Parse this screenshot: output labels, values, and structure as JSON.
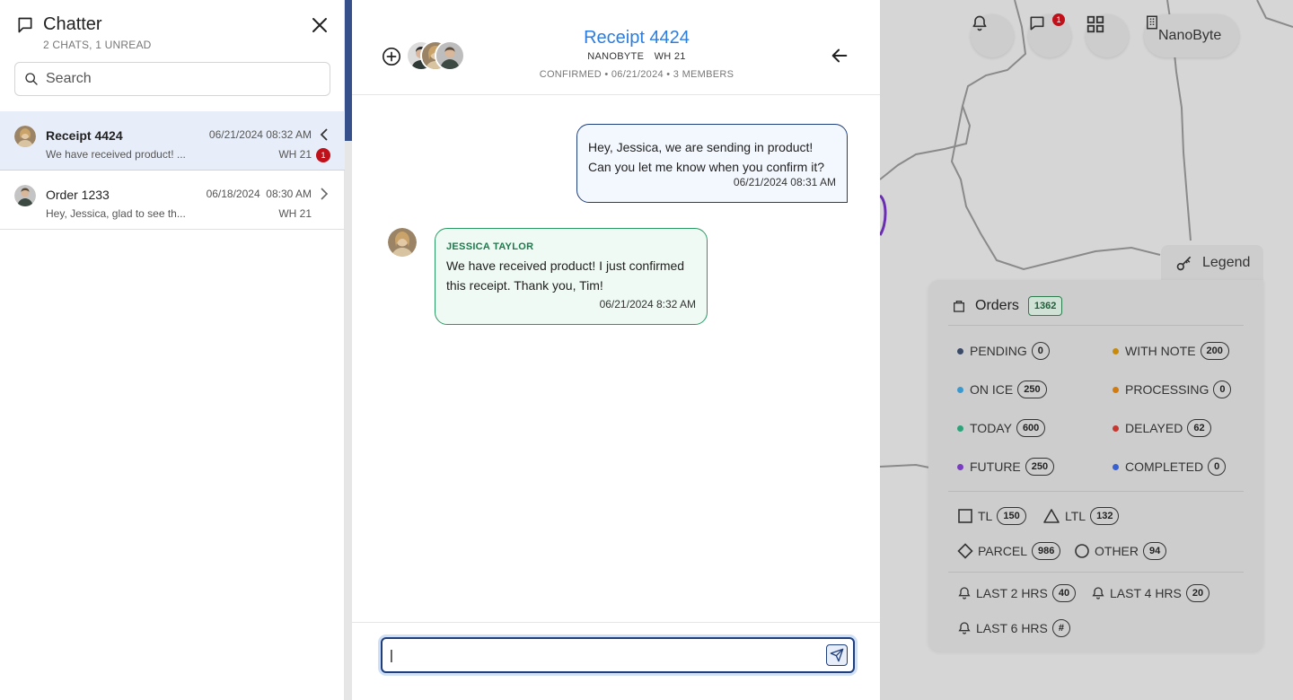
{
  "sidebar": {
    "title": "Chatter",
    "subtitle": "2 CHATS, 1 UNREAD",
    "search_placeholder": "Search",
    "chats": [
      {
        "name": "Receipt 4424",
        "time": "06/21/2024 08:32 AM",
        "preview": "We have received product! ...",
        "warehouse": "WH 21",
        "unread": "1"
      },
      {
        "name": "Order 1233",
        "time": "06/18/2024  08:30 AM",
        "preview": "Hey, Jessica, glad to see th...",
        "warehouse": "WH 21"
      }
    ]
  },
  "chat": {
    "title": "Receipt 4424",
    "tags": [
      "NANOBYTE",
      "WH 21"
    ],
    "meta": "CONFIRMED • 06/21/2024 • 3 MEMBERS",
    "messages": [
      {
        "direction": "out",
        "text": "Hey, Jessica, we are sending in product! Can you let me know when you confirm it?",
        "time": "06/21/2024 08:31 AM"
      },
      {
        "direction": "in",
        "sender": "JESSICA TAYLOR",
        "text": "We have received product! I just confirmed this receipt. Thank you, Tim!",
        "time": "06/21/2024 8:32 AM"
      }
    ],
    "composer_value": "|"
  },
  "topbar": {
    "messages_badge": "1",
    "org_name": "NanoByte"
  },
  "legend": {
    "tab_label": "Legend",
    "orders_label": "Orders",
    "orders_count": "1362",
    "statuses": [
      {
        "label": "PENDING",
        "count": "0",
        "color": "#3b4a66"
      },
      {
        "label": "WITH NOTE",
        "count": "200",
        "color": "#c98a0a"
      },
      {
        "label": "ON ICE",
        "count": "250",
        "color": "#3a9ad0"
      },
      {
        "label": "PROCESSING",
        "count": "0",
        "color": "#d07a12"
      },
      {
        "label": "TODAY",
        "count": "600",
        "color": "#2ea37a"
      },
      {
        "label": "DELAYED",
        "count": "62",
        "color": "#c9362e"
      },
      {
        "label": "FUTURE",
        "count": "250",
        "color": "#7b3cc4"
      },
      {
        "label": "COMPLETED",
        "count": "0",
        "color": "#3a5fcf"
      }
    ],
    "shipment_types": [
      {
        "label": "TL",
        "count": "150",
        "icon": "square-icon"
      },
      {
        "label": "LTL",
        "count": "132",
        "icon": "triangle-icon"
      },
      {
        "label": "PARCEL",
        "count": "986",
        "icon": "diamond-icon"
      },
      {
        "label": "OTHER",
        "count": "94",
        "icon": "circle-icon"
      }
    ],
    "alerts": [
      {
        "label": "LAST 2 HRS",
        "count": "40"
      },
      {
        "label": "LAST 4 HRS",
        "count": "20"
      },
      {
        "label": "LAST 6 HRS",
        "count": "#"
      }
    ]
  },
  "colors": {
    "accent_blue": "#2b7de0",
    "navy": "#1f3e7c",
    "green": "#2a9a64",
    "badge_red": "#c0101a"
  }
}
